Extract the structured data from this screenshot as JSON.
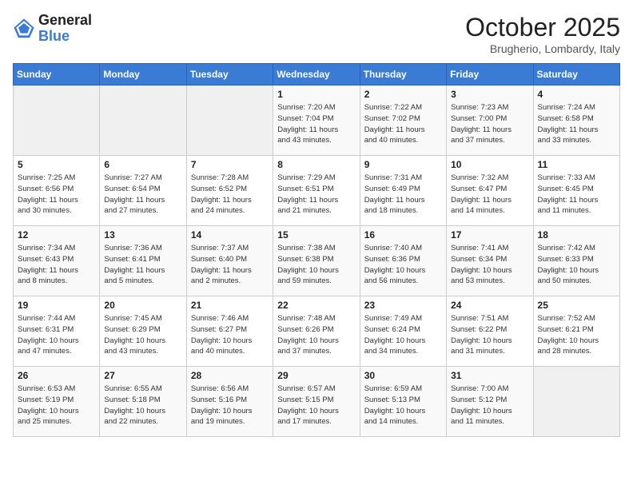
{
  "header": {
    "logo_line1": "General",
    "logo_line2": "Blue",
    "month": "October 2025",
    "location": "Brugherio, Lombardy, Italy"
  },
  "days_of_week": [
    "Sunday",
    "Monday",
    "Tuesday",
    "Wednesday",
    "Thursday",
    "Friday",
    "Saturday"
  ],
  "weeks": [
    [
      {
        "day": "",
        "info": ""
      },
      {
        "day": "",
        "info": ""
      },
      {
        "day": "",
        "info": ""
      },
      {
        "day": "1",
        "info": "Sunrise: 7:20 AM\nSunset: 7:04 PM\nDaylight: 11 hours\nand 43 minutes."
      },
      {
        "day": "2",
        "info": "Sunrise: 7:22 AM\nSunset: 7:02 PM\nDaylight: 11 hours\nand 40 minutes."
      },
      {
        "day": "3",
        "info": "Sunrise: 7:23 AM\nSunset: 7:00 PM\nDaylight: 11 hours\nand 37 minutes."
      },
      {
        "day": "4",
        "info": "Sunrise: 7:24 AM\nSunset: 6:58 PM\nDaylight: 11 hours\nand 33 minutes."
      }
    ],
    [
      {
        "day": "5",
        "info": "Sunrise: 7:25 AM\nSunset: 6:56 PM\nDaylight: 11 hours\nand 30 minutes."
      },
      {
        "day": "6",
        "info": "Sunrise: 7:27 AM\nSunset: 6:54 PM\nDaylight: 11 hours\nand 27 minutes."
      },
      {
        "day": "7",
        "info": "Sunrise: 7:28 AM\nSunset: 6:52 PM\nDaylight: 11 hours\nand 24 minutes."
      },
      {
        "day": "8",
        "info": "Sunrise: 7:29 AM\nSunset: 6:51 PM\nDaylight: 11 hours\nand 21 minutes."
      },
      {
        "day": "9",
        "info": "Sunrise: 7:31 AM\nSunset: 6:49 PM\nDaylight: 11 hours\nand 18 minutes."
      },
      {
        "day": "10",
        "info": "Sunrise: 7:32 AM\nSunset: 6:47 PM\nDaylight: 11 hours\nand 14 minutes."
      },
      {
        "day": "11",
        "info": "Sunrise: 7:33 AM\nSunset: 6:45 PM\nDaylight: 11 hours\nand 11 minutes."
      }
    ],
    [
      {
        "day": "12",
        "info": "Sunrise: 7:34 AM\nSunset: 6:43 PM\nDaylight: 11 hours\nand 8 minutes."
      },
      {
        "day": "13",
        "info": "Sunrise: 7:36 AM\nSunset: 6:41 PM\nDaylight: 11 hours\nand 5 minutes."
      },
      {
        "day": "14",
        "info": "Sunrise: 7:37 AM\nSunset: 6:40 PM\nDaylight: 11 hours\nand 2 minutes."
      },
      {
        "day": "15",
        "info": "Sunrise: 7:38 AM\nSunset: 6:38 PM\nDaylight: 10 hours\nand 59 minutes."
      },
      {
        "day": "16",
        "info": "Sunrise: 7:40 AM\nSunset: 6:36 PM\nDaylight: 10 hours\nand 56 minutes."
      },
      {
        "day": "17",
        "info": "Sunrise: 7:41 AM\nSunset: 6:34 PM\nDaylight: 10 hours\nand 53 minutes."
      },
      {
        "day": "18",
        "info": "Sunrise: 7:42 AM\nSunset: 6:33 PM\nDaylight: 10 hours\nand 50 minutes."
      }
    ],
    [
      {
        "day": "19",
        "info": "Sunrise: 7:44 AM\nSunset: 6:31 PM\nDaylight: 10 hours\nand 47 minutes."
      },
      {
        "day": "20",
        "info": "Sunrise: 7:45 AM\nSunset: 6:29 PM\nDaylight: 10 hours\nand 43 minutes."
      },
      {
        "day": "21",
        "info": "Sunrise: 7:46 AM\nSunset: 6:27 PM\nDaylight: 10 hours\nand 40 minutes."
      },
      {
        "day": "22",
        "info": "Sunrise: 7:48 AM\nSunset: 6:26 PM\nDaylight: 10 hours\nand 37 minutes."
      },
      {
        "day": "23",
        "info": "Sunrise: 7:49 AM\nSunset: 6:24 PM\nDaylight: 10 hours\nand 34 minutes."
      },
      {
        "day": "24",
        "info": "Sunrise: 7:51 AM\nSunset: 6:22 PM\nDaylight: 10 hours\nand 31 minutes."
      },
      {
        "day": "25",
        "info": "Sunrise: 7:52 AM\nSunset: 6:21 PM\nDaylight: 10 hours\nand 28 minutes."
      }
    ],
    [
      {
        "day": "26",
        "info": "Sunrise: 6:53 AM\nSunset: 5:19 PM\nDaylight: 10 hours\nand 25 minutes."
      },
      {
        "day": "27",
        "info": "Sunrise: 6:55 AM\nSunset: 5:18 PM\nDaylight: 10 hours\nand 22 minutes."
      },
      {
        "day": "28",
        "info": "Sunrise: 6:56 AM\nSunset: 5:16 PM\nDaylight: 10 hours\nand 19 minutes."
      },
      {
        "day": "29",
        "info": "Sunrise: 6:57 AM\nSunset: 5:15 PM\nDaylight: 10 hours\nand 17 minutes."
      },
      {
        "day": "30",
        "info": "Sunrise: 6:59 AM\nSunset: 5:13 PM\nDaylight: 10 hours\nand 14 minutes."
      },
      {
        "day": "31",
        "info": "Sunrise: 7:00 AM\nSunset: 5:12 PM\nDaylight: 10 hours\nand 11 minutes."
      },
      {
        "day": "",
        "info": ""
      }
    ]
  ]
}
